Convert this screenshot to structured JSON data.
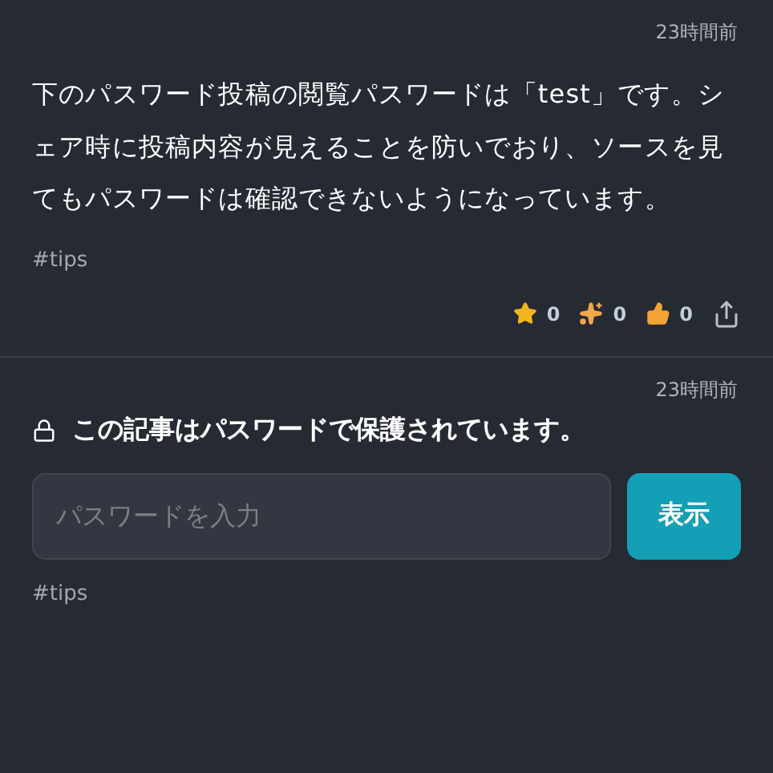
{
  "posts": [
    {
      "kind": "open",
      "time": "23時間前",
      "body": "下のパスワード投稿の閲覧パスワードは「test」です。シェア時に投稿内容が見えることを防いでおり、ソースを見てもパスワードは確認できないようになっています。",
      "tag": "#tips",
      "reactions": [
        {
          "kind": "star",
          "count": "0"
        },
        {
          "kind": "sparkles",
          "count": "0"
        },
        {
          "kind": "thumbs",
          "count": "0"
        }
      ]
    },
    {
      "kind": "locked",
      "time": "23時間前",
      "notice": "この記事はパスワードで保護されています。",
      "placeholder": "パスワードを入力",
      "button": "表示",
      "tag": "#tips"
    }
  ]
}
